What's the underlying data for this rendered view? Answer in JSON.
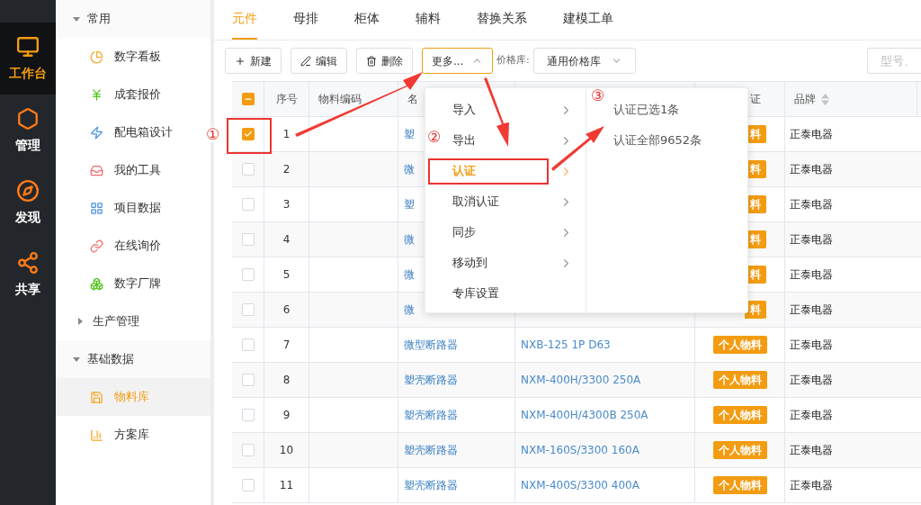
{
  "nav_rail": [
    {
      "label": "工作台",
      "selected": true
    },
    {
      "label": "管理",
      "selected": false
    },
    {
      "label": "发现",
      "selected": false
    },
    {
      "label": "共享",
      "selected": false
    }
  ],
  "sidebar": {
    "groups": [
      {
        "label": "常用",
        "expanded": true,
        "items": [
          {
            "label": "数字看板",
            "selected": false
          },
          {
            "label": "成套报价",
            "selected": false
          },
          {
            "label": "配电箱设计",
            "selected": false
          },
          {
            "label": "我的工具",
            "selected": false
          },
          {
            "label": "项目数据",
            "selected": false
          },
          {
            "label": "在线询价",
            "selected": false
          },
          {
            "label": "数字厂牌",
            "selected": false
          }
        ]
      },
      {
        "label": "生产管理",
        "expanded": false
      },
      {
        "label": "基础数据",
        "expanded": true,
        "items": [
          {
            "label": "物料库",
            "selected": true
          },
          {
            "label": "方案库",
            "selected": false
          }
        ]
      }
    ]
  },
  "tabs": [
    {
      "label": "元件",
      "selected": true
    },
    {
      "label": "母排",
      "selected": false
    },
    {
      "label": "柜体",
      "selected": false
    },
    {
      "label": "辅料",
      "selected": false
    },
    {
      "label": "替换关系",
      "selected": false
    },
    {
      "label": "建模工单",
      "selected": false
    }
  ],
  "toolbar": {
    "buttons": [
      {
        "label": "新建"
      },
      {
        "label": "编辑"
      },
      {
        "label": "删除"
      }
    ],
    "more_button": {
      "label": "更多...",
      "expanded": true
    },
    "price_library": {
      "label": "价格库:",
      "value": "通用价格库"
    },
    "search": {
      "placeholder": "型号、"
    }
  },
  "table": {
    "select_all_indeterminate": true,
    "columns": [
      {
        "label": "序号",
        "sortable": false
      },
      {
        "label": "物料编码",
        "sortable": false
      },
      {
        "label": "名",
        "sortable": false
      },
      {
        "label": "证",
        "sortable": false
      },
      {
        "label": "品牌",
        "sortable": true
      }
    ],
    "rows": [
      {
        "checked": true,
        "index": "1",
        "name": "塑",
        "badge": "料",
        "brand": "正泰电器",
        "covered": true
      },
      {
        "checked": false,
        "index": "2",
        "name": "微",
        "badge": "料",
        "brand": "正泰电器",
        "covered": true
      },
      {
        "checked": false,
        "index": "3",
        "name": "塑",
        "badge": "料",
        "brand": "正泰电器",
        "covered": true
      },
      {
        "checked": false,
        "index": "4",
        "name": "微",
        "badge": "料",
        "brand": "正泰电器",
        "covered": true
      },
      {
        "checked": false,
        "index": "5",
        "name": "微",
        "badge": "料",
        "brand": "正泰电器",
        "covered": true
      },
      {
        "checked": false,
        "index": "6",
        "name": "微",
        "badge": "料",
        "brand": "正泰电器",
        "covered": true
      },
      {
        "checked": false,
        "index": "7",
        "name": "微型断路器",
        "model": "NXB-125 1P D63",
        "badge": "个人物料",
        "brand": "正泰电器",
        "covered": false
      },
      {
        "checked": false,
        "index": "8",
        "name": "塑壳断路器",
        "model": "NXM-400H/3300 250A",
        "badge": "个人物料",
        "brand": "正泰电器",
        "covered": false
      },
      {
        "checked": false,
        "index": "9",
        "name": "塑壳断路器",
        "model": "NXM-400H/4300B 250A",
        "badge": "个人物料",
        "brand": "正泰电器",
        "covered": false
      },
      {
        "checked": false,
        "index": "10",
        "name": "塑壳断路器",
        "model": "NXM-160S/3300 160A",
        "badge": "个人物料",
        "brand": "正泰电器",
        "covered": false
      },
      {
        "checked": false,
        "index": "11",
        "name": "塑壳断路器",
        "model": "NXM-400S/3300 400A",
        "badge": "个人物料",
        "brand": "正泰电器",
        "covered": false
      }
    ]
  },
  "dropdown_menu": {
    "items": [
      {
        "label": "导入",
        "submenu": true,
        "selected": false
      },
      {
        "label": "导出",
        "submenu": true,
        "selected": false
      },
      {
        "label": "认证",
        "submenu": true,
        "selected": true
      },
      {
        "label": "取消认证",
        "submenu": true,
        "selected": false
      },
      {
        "label": "同步",
        "submenu": true,
        "selected": false
      },
      {
        "label": "移动到",
        "submenu": true,
        "selected": false
      },
      {
        "label": "专库设置",
        "submenu": false,
        "selected": false
      }
    ],
    "submenu": [
      {
        "label": "认证已选1条"
      },
      {
        "label": "认证全部9652条"
      }
    ]
  },
  "annotations": {
    "markers": [
      "①",
      "②",
      "③"
    ]
  }
}
